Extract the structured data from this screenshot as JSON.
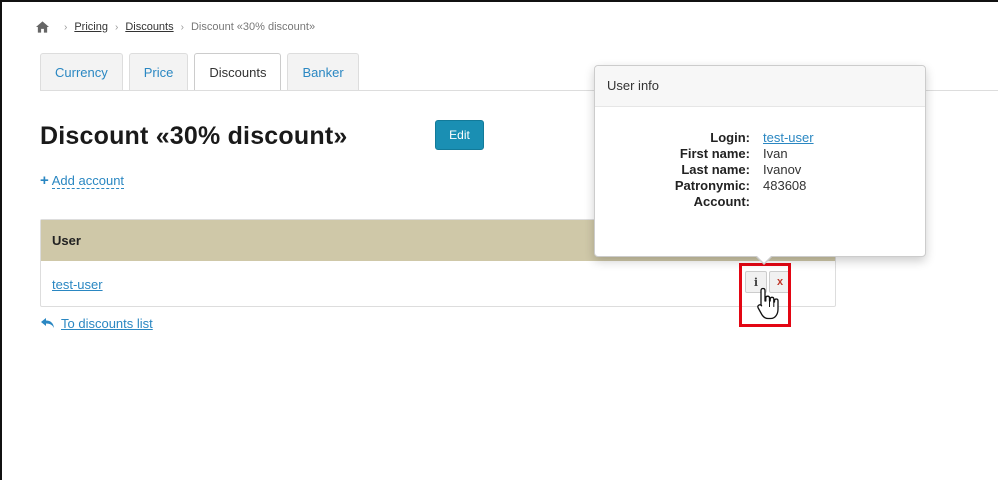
{
  "breadcrumb": {
    "pricing": "Pricing",
    "discounts": "Discounts",
    "current": "Discount «30% discount»",
    "separator": "›"
  },
  "tabs": [
    {
      "label": "Currency",
      "active": false
    },
    {
      "label": "Price",
      "active": false
    },
    {
      "label": "Discounts",
      "active": true
    },
    {
      "label": "Banker",
      "active": false
    }
  ],
  "page": {
    "title": "Discount «30% discount»",
    "edit_label": "Edit",
    "add_account": "Add account",
    "back_link": "To discounts list"
  },
  "table": {
    "header": "User",
    "rows": [
      {
        "user": "test-user"
      }
    ],
    "info_glyph": "i",
    "delete_glyph": "x"
  },
  "popover": {
    "title": "User info",
    "fields": [
      {
        "key": "Login:",
        "value": "test-user",
        "link": true
      },
      {
        "key": "First name:",
        "value": "Ivan"
      },
      {
        "key": "Last name:",
        "value": "Ivanov"
      },
      {
        "key": "Patronymic:",
        "value": "483608"
      },
      {
        "key": "Account:",
        "value": ""
      }
    ]
  },
  "colors": {
    "accent": "#1a8fb3",
    "link": "#2a87c2",
    "table_header": "#cfc8a8",
    "highlight": "#e30613"
  },
  "icons": {
    "home": "home-icon",
    "plus": "plus-icon",
    "back": "reply-arrow-icon",
    "cursor": "hand-pointer-icon"
  }
}
